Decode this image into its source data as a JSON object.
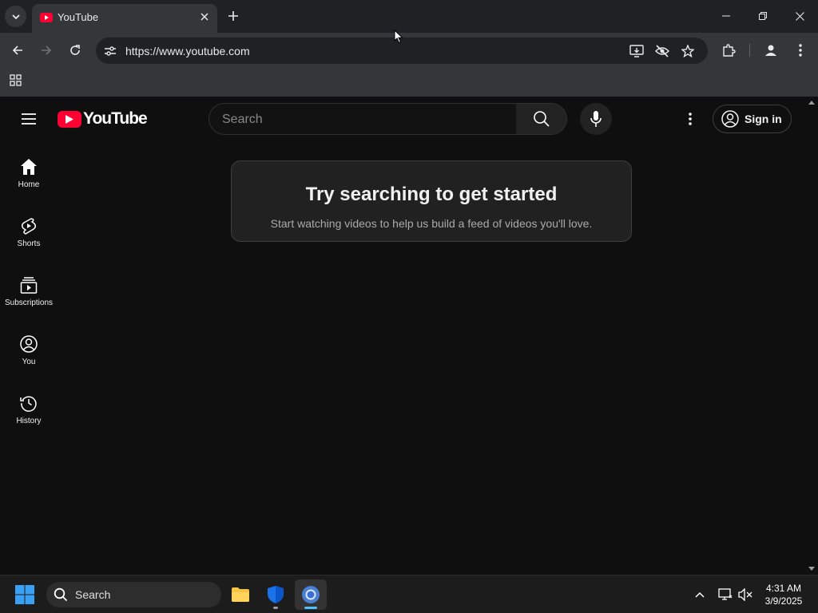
{
  "browser": {
    "tab_title": "YouTube",
    "url": "https://www.youtube.com"
  },
  "youtube": {
    "logo_text": "YouTube",
    "search_placeholder": "Search",
    "signin_label": "Sign in",
    "sidebar": [
      {
        "label": "Home",
        "icon": "home-icon"
      },
      {
        "label": "Shorts",
        "icon": "shorts-icon"
      },
      {
        "label": "Subscriptions",
        "icon": "subscriptions-icon"
      },
      {
        "label": "You",
        "icon": "you-icon"
      },
      {
        "label": "History",
        "icon": "history-icon"
      }
    ],
    "empty_state": {
      "title": "Try searching to get started",
      "subtitle": "Start watching videos to help us build a feed of videos you'll love."
    }
  },
  "taskbar": {
    "search_label": "Search",
    "time": "4:31 AM",
    "date": "3/9/2025"
  },
  "colors": {
    "brand_red": "#ff0033",
    "page_bg": "#0f0f0f",
    "chrome_bg": "#35363a"
  }
}
